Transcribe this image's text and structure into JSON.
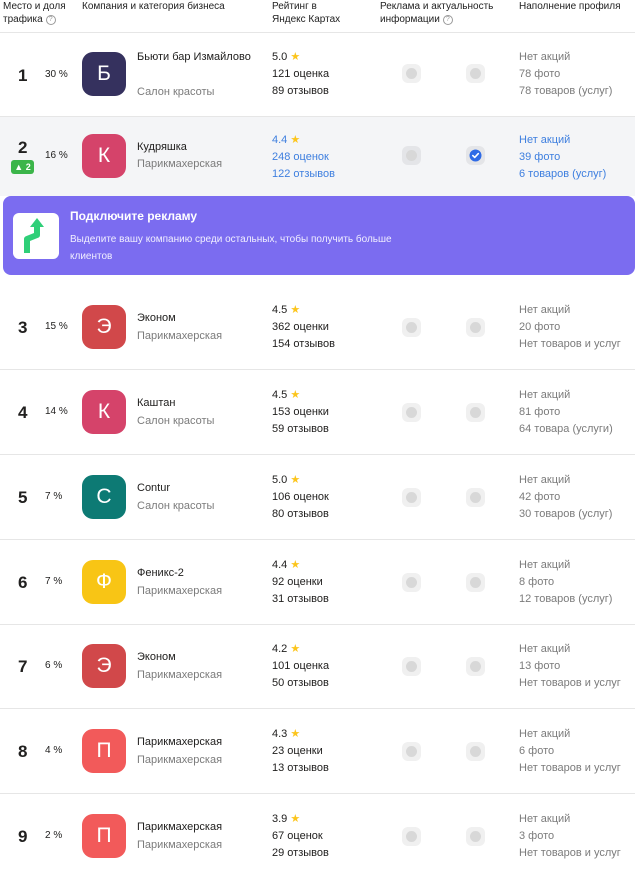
{
  "header": {
    "col_place": "Место и доля трафика",
    "col_company": "Компания и категория бизнеса",
    "col_rating": "Рейтинг в Яндекс Картах",
    "col_ads": "Реклама и актуальность информации",
    "col_profile": "Наполнение профиля"
  },
  "promo": {
    "title": "Подключите рекламу",
    "text": "Выделите вашу компанию среди остальных, чтобы получить больше клиентов"
  },
  "rows": [
    {
      "place": "1",
      "share": "30 %",
      "letter": "Б",
      "color": "#35315e",
      "name": "Бьюти бар Измайлово",
      "category": "Салон красоты",
      "rating": "5.0",
      "ratings": "121 оценка",
      "reviews": "89 отзывов",
      "promo": "Нет акций",
      "photos": "78 фото",
      "goods": "78 товаров (услуг)"
    },
    {
      "place": "2",
      "share": "16 %",
      "up": "2",
      "letter": "К",
      "color": "#d5436a",
      "name": "Кудряшка",
      "category": "Парикмахерская",
      "rating": "4.4",
      "ratings": "248 оценок",
      "reviews": "122 отзывов",
      "promo": "Нет акций",
      "photos": "39 фото",
      "goods": "6 товаров (услуг)"
    },
    {
      "place": "3",
      "share": "15 %",
      "letter": "Э",
      "color": "#d1484a",
      "name": "Эконом",
      "category": "Парикмахерская",
      "rating": "4.5",
      "ratings": "362 оценки",
      "reviews": "154 отзывов",
      "promo": "Нет акций",
      "photos": "20 фото",
      "goods": "Нет товаров и услуг"
    },
    {
      "place": "4",
      "share": "14 %",
      "letter": "К",
      "color": "#d5436a",
      "name": "Каштан",
      "category": "Салон красоты",
      "rating": "4.5",
      "ratings": "153 оценки",
      "reviews": "59 отзывов",
      "promo": "Нет акций",
      "photos": "81 фото",
      "goods": "64 товара (услуги)"
    },
    {
      "place": "5",
      "share": "7 %",
      "letter": "С",
      "color": "#0d7a74",
      "name": "Contur",
      "category": "Салон красоты",
      "rating": "5.0",
      "ratings": "106 оценок",
      "reviews": "80 отзывов",
      "promo": "Нет акций",
      "photos": "42 фото",
      "goods": "30 товаров (услуг)"
    },
    {
      "place": "6",
      "share": "7 %",
      "letter": "Ф",
      "color": "#f8c515",
      "name": "Феникс-2",
      "category": "Парикмахерская",
      "rating": "4.4",
      "ratings": "92 оценки",
      "reviews": "31 отзывов",
      "promo": "Нет акций",
      "photos": "8 фото",
      "goods": "12 товаров (услуг)"
    },
    {
      "place": "7",
      "share": "6 %",
      "letter": "Э",
      "color": "#d1484a",
      "name": "Эконом",
      "category": "Парикмахерская",
      "rating": "4.2",
      "ratings": "101 оценка",
      "reviews": "50 отзывов",
      "promo": "Нет акций",
      "photos": "13 фото",
      "goods": "Нет товаров и услуг"
    },
    {
      "place": "8",
      "share": "4 %",
      "letter": "П",
      "color": "#f25a5a",
      "name": "Парикмахерская",
      "category": "Парикмахерская",
      "rating": "4.3",
      "ratings": "23 оценки",
      "reviews": "13 отзывов",
      "promo": "Нет акций",
      "photos": "6 фото",
      "goods": "Нет товаров и услуг"
    },
    {
      "place": "9",
      "share": "2 %",
      "letter": "П",
      "color": "#f25a5a",
      "name": "Парикмахерская",
      "category": "Парикмахерская",
      "rating": "3.9",
      "ratings": "67 оценок",
      "reviews": "29 отзывов",
      "promo": "Нет акций",
      "photos": "3 фото",
      "goods": "Нет товаров и услуг"
    }
  ]
}
